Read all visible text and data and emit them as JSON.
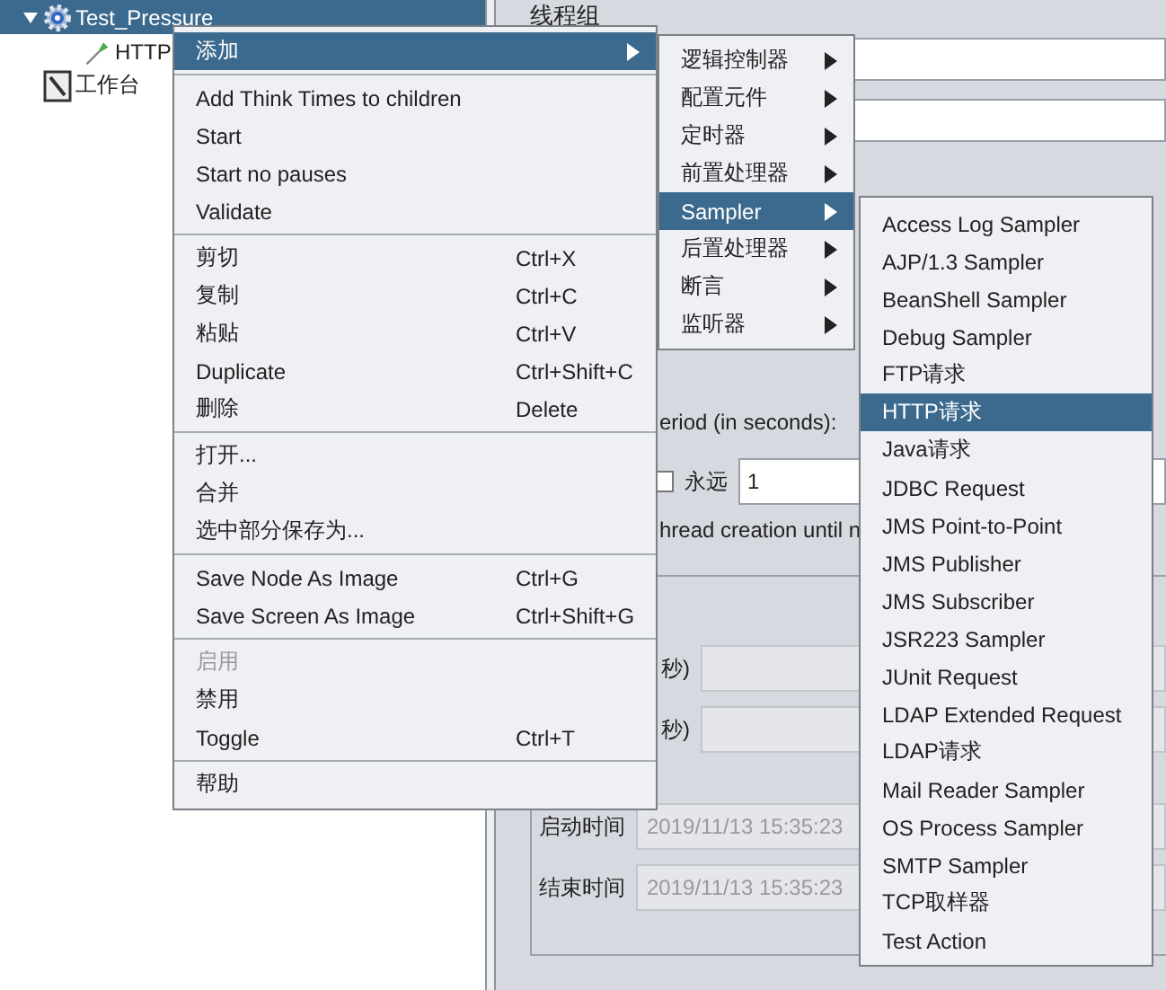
{
  "tree": [
    {
      "label": "Test_Pressure",
      "kind": "thread_group",
      "selected": true,
      "expanded": true,
      "children": [
        {
          "label": "HTTP",
          "kind": "sampler",
          "selected": false
        }
      ]
    },
    {
      "label": "工作台",
      "kind": "workbench",
      "selected": false
    }
  ],
  "panel": {
    "title": "线程组",
    "ramp_label": "eriod (in seconds):",
    "loop_forever": {
      "label": "永远",
      "checked": false
    },
    "loop_value": "1",
    "delay_label": "hread creation until n",
    "duration_label": "秒)",
    "delay_field_label": "秒)",
    "start_label": "启动时间",
    "start_value": "2019/11/13 15:35:23",
    "end_label": "结束时间",
    "end_value": "2019/11/13 15:35:23"
  },
  "context_menu": {
    "sections": [
      [
        {
          "label": "添加",
          "selected": true,
          "submenu": true,
          "disabled": false
        }
      ],
      [
        {
          "label": "Add Think Times to children",
          "selected": false,
          "disabled": false
        },
        {
          "label": "Start",
          "selected": false,
          "disabled": false
        },
        {
          "label": "Start no pauses",
          "selected": false,
          "disabled": false
        },
        {
          "label": "Validate",
          "selected": false,
          "disabled": false
        }
      ],
      [
        {
          "label": "剪切",
          "shortcut": "Ctrl+X",
          "selected": false,
          "disabled": false
        },
        {
          "label": "复制",
          "shortcut": "Ctrl+C",
          "selected": false,
          "disabled": false
        },
        {
          "label": "粘贴",
          "shortcut": "Ctrl+V",
          "selected": false,
          "disabled": false
        },
        {
          "label": "Duplicate",
          "shortcut": "Ctrl+Shift+C",
          "selected": false,
          "disabled": false
        },
        {
          "label": "删除",
          "shortcut": "Delete",
          "selected": false,
          "disabled": false
        }
      ],
      [
        {
          "label": "打开...",
          "selected": false,
          "disabled": false
        },
        {
          "label": "合并",
          "selected": false,
          "disabled": false
        },
        {
          "label": "选中部分保存为...",
          "selected": false,
          "disabled": false
        }
      ],
      [
        {
          "label": "Save Node As Image",
          "shortcut": "Ctrl+G",
          "selected": false,
          "disabled": false
        },
        {
          "label": "Save Screen As Image",
          "shortcut": "Ctrl+Shift+G",
          "selected": false,
          "disabled": false
        }
      ],
      [
        {
          "label": "启用",
          "selected": false,
          "disabled": true
        },
        {
          "label": "禁用",
          "selected": false,
          "disabled": false
        },
        {
          "label": "Toggle",
          "shortcut": "Ctrl+T",
          "selected": false,
          "disabled": false
        }
      ],
      [
        {
          "label": "帮助",
          "selected": false,
          "disabled": false
        }
      ]
    ]
  },
  "add_menu": {
    "items": [
      {
        "label": "逻辑控制器",
        "selected": false,
        "submenu": true
      },
      {
        "label": "配置元件",
        "selected": false,
        "submenu": true
      },
      {
        "label": "定时器",
        "selected": false,
        "submenu": true
      },
      {
        "label": "前置处理器",
        "selected": false,
        "submenu": true
      },
      {
        "label": "Sampler",
        "selected": true,
        "submenu": true
      },
      {
        "label": "后置处理器",
        "selected": false,
        "submenu": true
      },
      {
        "label": "断言",
        "selected": false,
        "submenu": true
      },
      {
        "label": "监听器",
        "selected": false,
        "submenu": true
      }
    ]
  },
  "sampler_menu": {
    "items": [
      {
        "label": "Access Log Sampler",
        "selected": false
      },
      {
        "label": "AJP/1.3 Sampler",
        "selected": false
      },
      {
        "label": "BeanShell Sampler",
        "selected": false
      },
      {
        "label": "Debug Sampler",
        "selected": false
      },
      {
        "label": "FTP请求",
        "selected": false
      },
      {
        "label": "HTTP请求",
        "selected": true
      },
      {
        "label": "Java请求",
        "selected": false
      },
      {
        "label": "JDBC Request",
        "selected": false
      },
      {
        "label": "JMS Point-to-Point",
        "selected": false
      },
      {
        "label": "JMS Publisher",
        "selected": false
      },
      {
        "label": "JMS Subscriber",
        "selected": false
      },
      {
        "label": "JSR223 Sampler",
        "selected": false
      },
      {
        "label": "JUnit Request",
        "selected": false
      },
      {
        "label": "LDAP Extended Request",
        "selected": false
      },
      {
        "label": "LDAP请求",
        "selected": false
      },
      {
        "label": "Mail Reader Sampler",
        "selected": false
      },
      {
        "label": "OS Process Sampler",
        "selected": false
      },
      {
        "label": "SMTP Sampler",
        "selected": false
      },
      {
        "label": "TCP取样器",
        "selected": false
      },
      {
        "label": "Test Action",
        "selected": false
      }
    ]
  }
}
